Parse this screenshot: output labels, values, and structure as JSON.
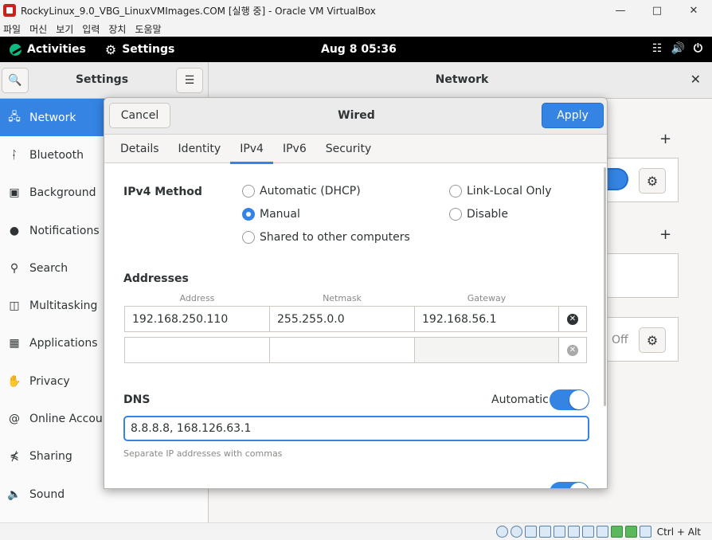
{
  "host": {
    "title": "RockyLinux_9.0_VBG_LinuxVMImages.COM [실행 중] - Oracle VM VirtualBox",
    "menu": [
      "파일",
      "머신",
      "보기",
      "입력",
      "장치",
      "도움말"
    ],
    "host_key": "Ctrl + Alt"
  },
  "topbar": {
    "activities": "Activities",
    "app": "Settings",
    "clock": "Aug 8  05:36"
  },
  "settings": {
    "sidebar_title": "Settings",
    "main_title": "Network",
    "sidebar": [
      {
        "label": "Network",
        "icon": "network-icon"
      },
      {
        "label": "Bluetooth",
        "icon": "bluetooth-icon"
      },
      {
        "label": "Background",
        "icon": "background-icon"
      },
      {
        "label": "Notifications",
        "icon": "bell-icon"
      },
      {
        "label": "Search",
        "icon": "search-icon"
      },
      {
        "label": "Multitasking",
        "icon": "multitasking-icon"
      },
      {
        "label": "Applications",
        "icon": "applications-icon"
      },
      {
        "label": "Privacy",
        "icon": "hand-icon"
      },
      {
        "label": "Online Accounts",
        "icon": "at-icon"
      },
      {
        "label": "Sharing",
        "icon": "share-icon"
      },
      {
        "label": "Sound",
        "icon": "speaker-icon"
      }
    ],
    "off_label": "Off"
  },
  "dialog": {
    "title": "Wired",
    "cancel": "Cancel",
    "apply": "Apply",
    "tabs": [
      "Details",
      "Identity",
      "IPv4",
      "IPv6",
      "Security"
    ],
    "active_tab": "IPv4",
    "ipv4_method_label": "IPv4 Method",
    "methods": {
      "dhcp": "Automatic (DHCP)",
      "manual": "Manual",
      "shared": "Shared to other computers",
      "link_local": "Link-Local Only",
      "disable": "Disable"
    },
    "selected_method": "Manual",
    "addresses_label": "Addresses",
    "columns": {
      "address": "Address",
      "netmask": "Netmask",
      "gateway": "Gateway"
    },
    "rows": [
      {
        "address": "192.168.250.110",
        "netmask": "255.255.0.0",
        "gateway": "192.168.56.1"
      },
      {
        "address": "",
        "netmask": "",
        "gateway": ""
      }
    ],
    "dns_label": "DNS",
    "automatic_label": "Automatic",
    "dns_automatic": true,
    "dns_value": "8.8.8.8, 168.126.63.1",
    "dns_hint": "Separate IP addresses with commas"
  },
  "colors": {
    "accent": "#3584e4",
    "topbar": "#000000"
  }
}
